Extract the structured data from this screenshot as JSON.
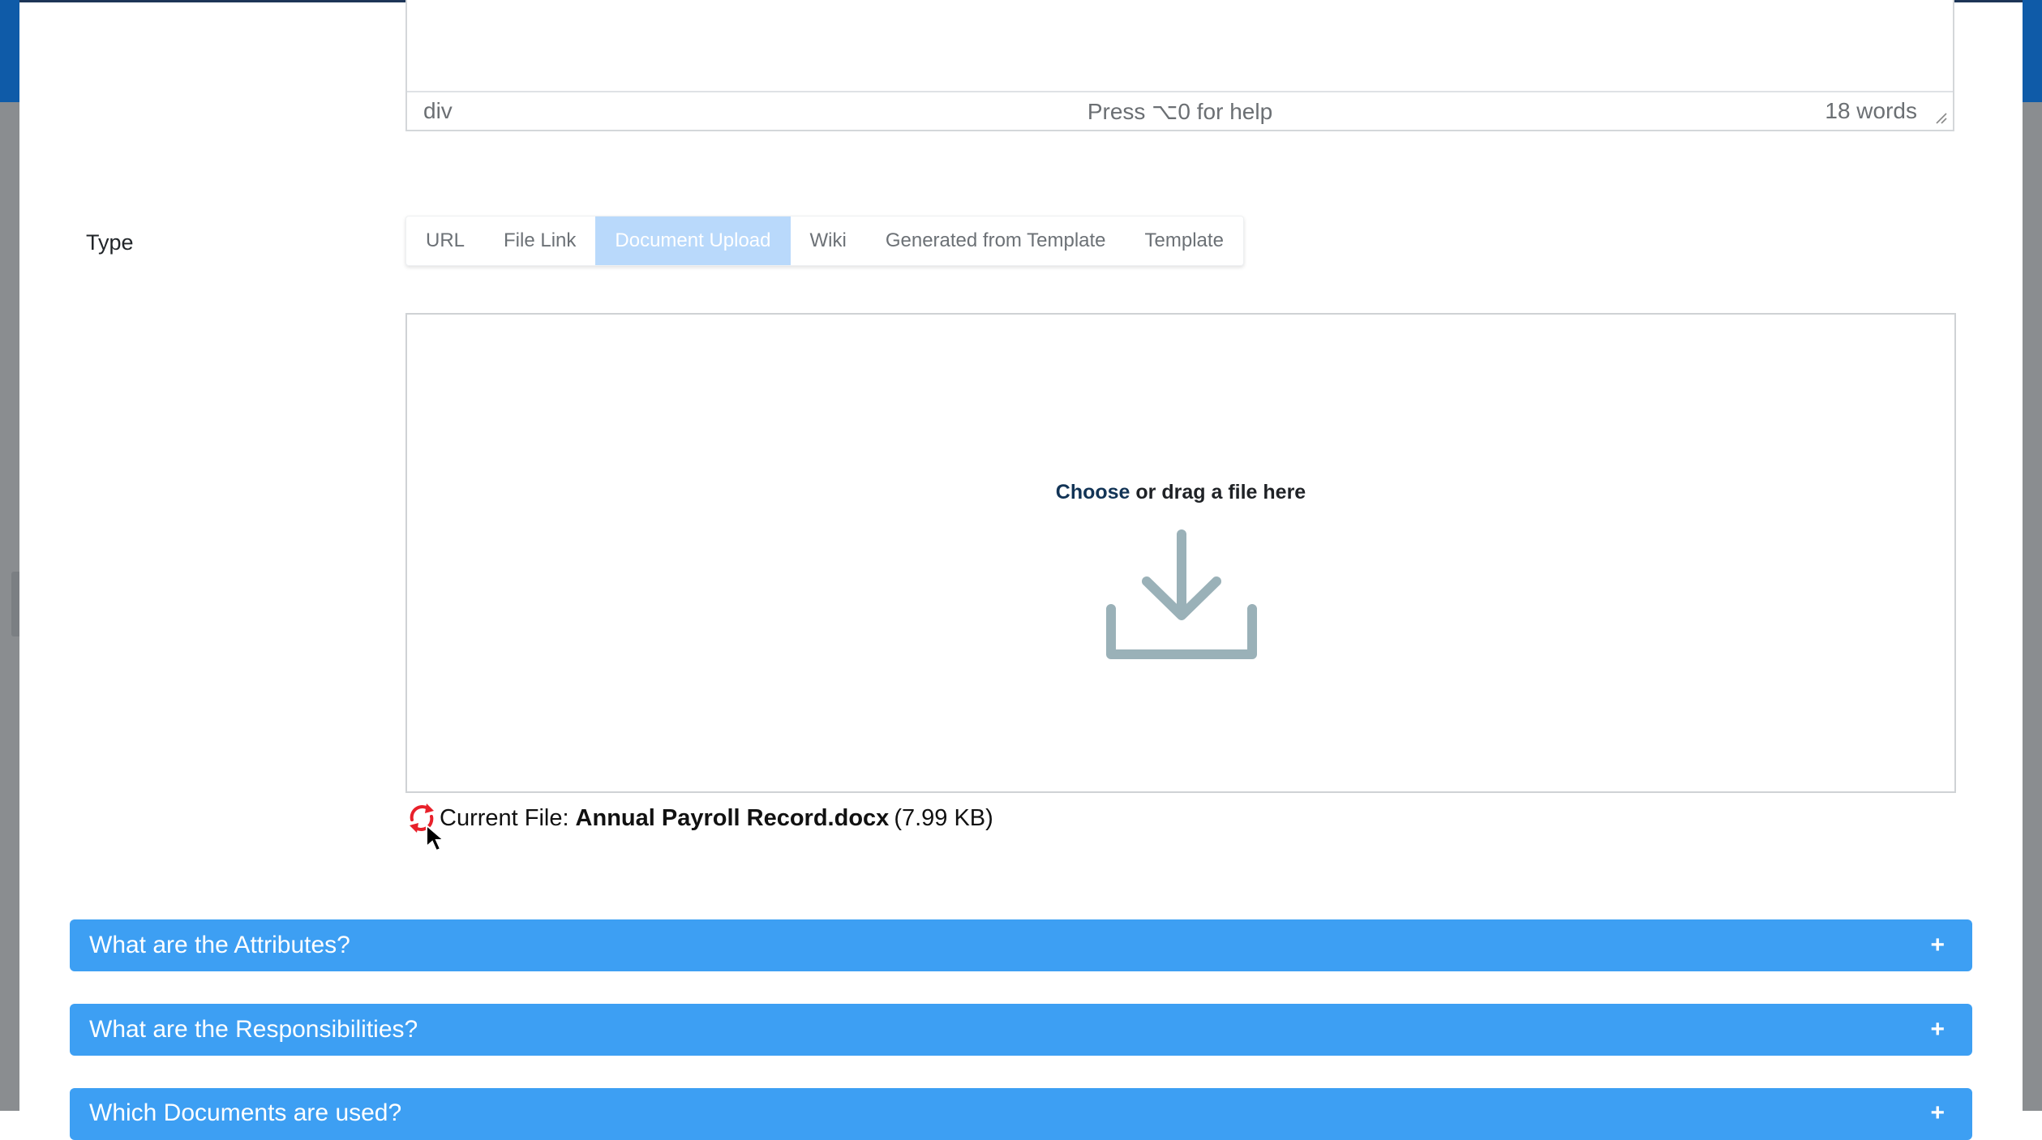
{
  "editor": {
    "element_path": "div",
    "help_text": "Press ⌥0 for help",
    "word_count": "18 words"
  },
  "type_field": {
    "label": "Type",
    "tabs": [
      {
        "label": "URL",
        "active": false
      },
      {
        "label": "File Link",
        "active": false
      },
      {
        "label": "Document Upload",
        "active": true
      },
      {
        "label": "Wiki",
        "active": false
      },
      {
        "label": "Generated from Template",
        "active": false
      },
      {
        "label": "Template",
        "active": false
      }
    ]
  },
  "upload": {
    "choose_link": "Choose",
    "drop_text": " or drag a file here",
    "icon": "download-icon"
  },
  "current_file": {
    "prefix": "Current File:",
    "file_name": "Annual Payroll Record.docx",
    "file_size": "(7.99 KB)",
    "replace_icon": "refresh-icon"
  },
  "accordions": [
    {
      "title": "What are the Attributes?",
      "toggle": "+"
    },
    {
      "title": "What are the Responsibilities?",
      "toggle": "+"
    },
    {
      "title": "Which Documents are used?",
      "toggle": "+"
    }
  ],
  "colors": {
    "accordion_bg": "#3d9ff3",
    "active_tab_bg": "#b9d9fb",
    "replace_icon": "#e8202a",
    "upload_icon": "#9ab1b8"
  }
}
